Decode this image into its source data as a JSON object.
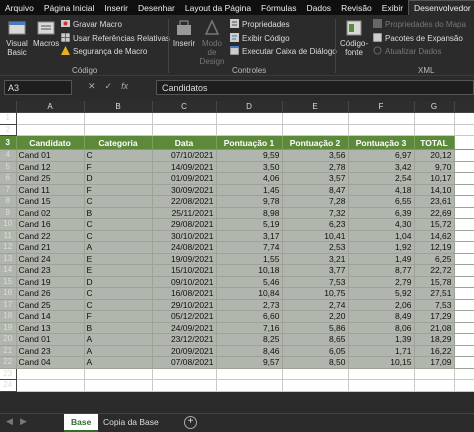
{
  "menu": {
    "items": [
      "Arquivo",
      "Página Inicial",
      "Inserir",
      "Desenhar",
      "Layout da Página",
      "Fórmulas",
      "Dados",
      "Revisão",
      "Exibir",
      "Desenvolvedor"
    ],
    "active": "Desenvolvedor"
  },
  "ribbon": {
    "codigo": {
      "visual_basic": "Visual Basic",
      "macros": "Macros",
      "gravar": "Gravar Macro",
      "referencias": "Usar Referências Relativas",
      "seguranca": "Segurança de Macro",
      "group": "Código"
    },
    "controles": {
      "inserir": "Inserir",
      "modo_design": "Modo de Design",
      "propriedades": "Propriedades",
      "exibir_codigo": "Exibir Código",
      "executar": "Executar Caixa de Diálogo",
      "group": "Controles"
    },
    "xml": {
      "codigo_fonte": "Código-fonte",
      "propriedades_mapa": "Propriedades do Mapa",
      "pacotes": "Pacotes de Expansão",
      "atualizar": "Atualizar Dados",
      "group": "XML"
    }
  },
  "formula_bar": {
    "name_box": "A3",
    "content": "Candidatos"
  },
  "columns": [
    "A",
    "B",
    "C",
    "D",
    "E",
    "F",
    "G"
  ],
  "row_numbers": [
    "1",
    "2",
    "3",
    "4",
    "5",
    "6",
    "7",
    "8",
    "9",
    "10",
    "11",
    "12",
    "13",
    "14",
    "15",
    "16",
    "17",
    "18",
    "19",
    "20",
    "21",
    "22",
    "23",
    "24"
  ],
  "table": {
    "headers": [
      "Candidato",
      "Categoria",
      "Data",
      "Pontuação 1",
      "Pontuação 2",
      "Pontuação 3",
      "TOTAL"
    ],
    "rows": [
      [
        "Cand 01",
        "C",
        "07/10/2021",
        "9,59",
        "3,56",
        "6,97",
        "20,12"
      ],
      [
        "Cand 12",
        "F",
        "14/09/2021",
        "3,50",
        "2,78",
        "3,42",
        "9,70"
      ],
      [
        "Cand 25",
        "D",
        "01/09/2021",
        "4,06",
        "3,57",
        "2,54",
        "10,17"
      ],
      [
        "Cand 11",
        "F",
        "30/09/2021",
        "1,45",
        "8,47",
        "4,18",
        "14,10"
      ],
      [
        "Cand 15",
        "C",
        "22/08/2021",
        "9,78",
        "7,28",
        "6,55",
        "23,61"
      ],
      [
        "Cand 02",
        "B",
        "25/11/2021",
        "8,98",
        "7,32",
        "6,39",
        "22,69"
      ],
      [
        "Cand 16",
        "C",
        "29/08/2021",
        "5,19",
        "6,23",
        "4,30",
        "15,72"
      ],
      [
        "Cand 22",
        "C",
        "30/10/2021",
        "3,17",
        "10,41",
        "1,04",
        "14,62"
      ],
      [
        "Cand 21",
        "A",
        "24/08/2021",
        "7,74",
        "2,53",
        "1,92",
        "12,19"
      ],
      [
        "Cand 24",
        "E",
        "19/09/2021",
        "1,55",
        "3,21",
        "1,49",
        "6,25"
      ],
      [
        "Cand 23",
        "E",
        "15/10/2021",
        "10,18",
        "3,77",
        "8,77",
        "22,72"
      ],
      [
        "Cand 19",
        "D",
        "09/10/2021",
        "5,46",
        "7,53",
        "2,79",
        "15,78"
      ],
      [
        "Cand 26",
        "C",
        "16/08/2021",
        "10,84",
        "10,75",
        "5,92",
        "27,51"
      ],
      [
        "Cand 25",
        "C",
        "29/10/2021",
        "2,73",
        "2,74",
        "2,06",
        "7,53"
      ],
      [
        "Cand 14",
        "F",
        "05/12/2021",
        "6,60",
        "2,20",
        "8,49",
        "17,29"
      ],
      [
        "Cand 13",
        "B",
        "24/09/2021",
        "7,16",
        "5,86",
        "8,06",
        "21,08"
      ],
      [
        "Cand 01",
        "A",
        "23/12/2021",
        "8,25",
        "8,65",
        "1,39",
        "18,29"
      ],
      [
        "Cand 23",
        "A",
        "20/09/2021",
        "8,46",
        "6,05",
        "1,71",
        "16,22"
      ],
      [
        "Cand 04",
        "A",
        "07/08/2021",
        "9,57",
        "8,50",
        "10,15",
        "17,09"
      ]
    ]
  },
  "sheet_tabs": [
    "Base",
    "Copia da Base"
  ],
  "active_tab": "Base",
  "colors": {
    "header_green": "#5c8a3a",
    "data_gray": "#b0b5ad",
    "tab_green": "#2d6e2d"
  }
}
